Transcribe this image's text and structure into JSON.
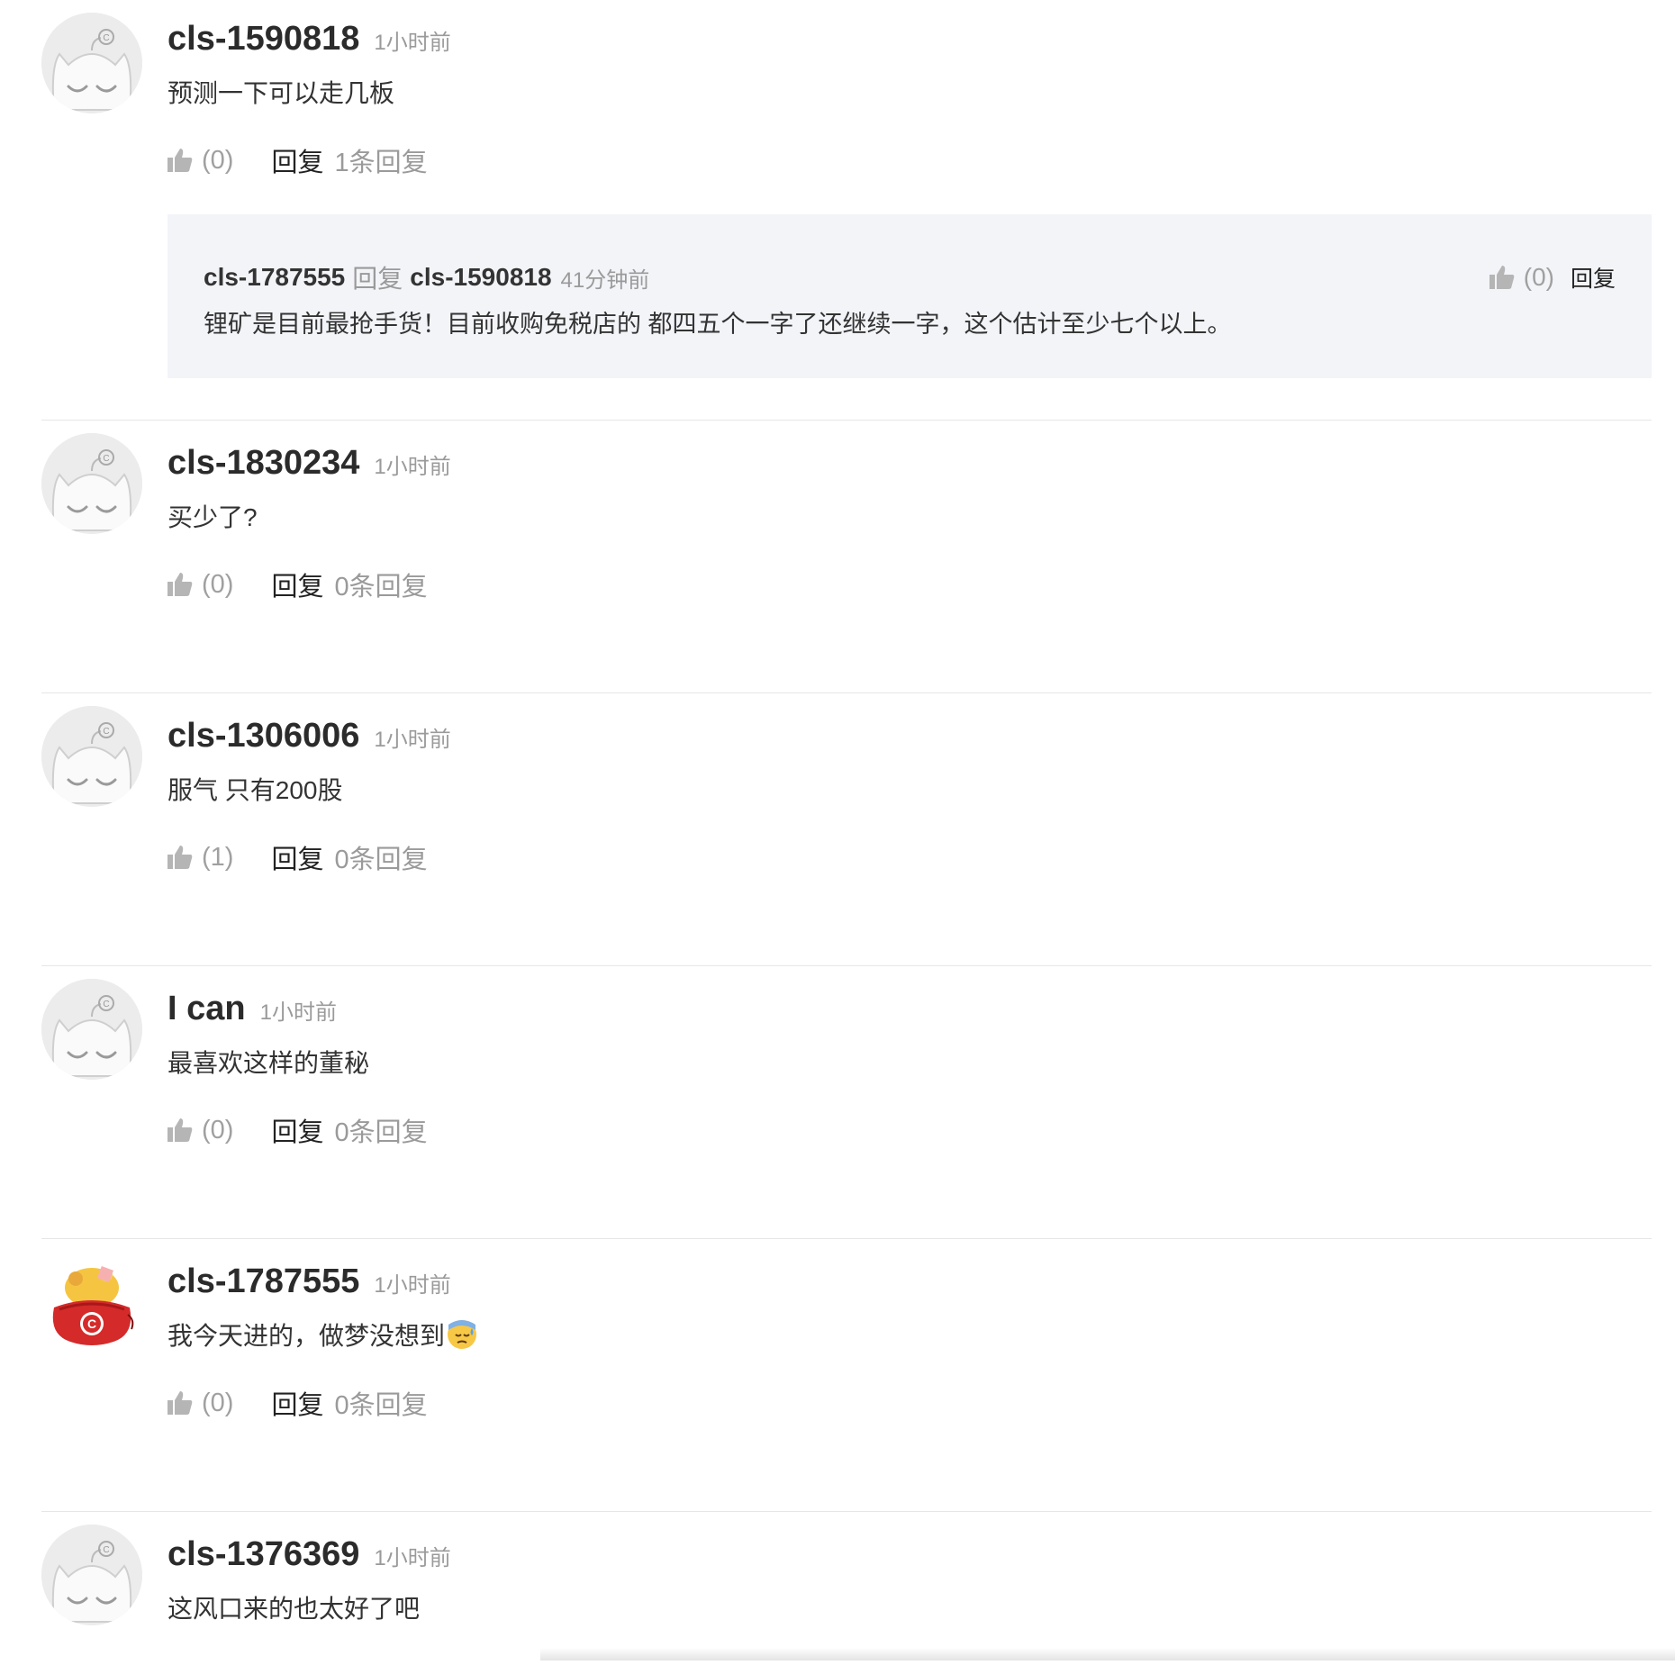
{
  "comments": [
    {
      "user": "cls-1590818",
      "time": "1小时前",
      "text": "预测一下可以走几板",
      "likes": "(0)",
      "reply_label": "回复",
      "reply_count": "1条回复",
      "avatar": "default-cat",
      "replies": [
        {
          "user": "cls-1787555",
          "word": "回复",
          "target": "cls-1590818",
          "time": "41分钟前",
          "likes": "(0)",
          "reply_label": "回复",
          "text": "锂矿是目前最抢手货！目前收购免税店的 都四五个一字了还继续一字，这个估计至少七个以上。"
        }
      ]
    },
    {
      "user": "cls-1830234",
      "time": "1小时前",
      "text": "买少了?",
      "likes": "(0)",
      "reply_label": "回复",
      "reply_count": "0条回复",
      "avatar": "default-cat"
    },
    {
      "user": "cls-1306006",
      "time": "1小时前",
      "text": "服气 只有200股",
      "likes": "(1)",
      "reply_label": "回复",
      "reply_count": "0条回复",
      "avatar": "default-cat"
    },
    {
      "user": "I can",
      "time": "1小时前",
      "text": "最喜欢这样的董秘",
      "likes": "(0)",
      "reply_label": "回复",
      "reply_count": "0条回复",
      "avatar": "default-cat"
    },
    {
      "user": "cls-1787555",
      "time": "1小时前",
      "text": "我今天进的，做梦没想到",
      "emoji": "sweat-face-emoji",
      "likes": "(0)",
      "reply_label": "回复",
      "reply_count": "0条回复",
      "avatar": "lucky-bag"
    },
    {
      "user": "cls-1376369",
      "time": "1小时前",
      "text": "这风口来的也太好了吧",
      "avatar": "default-cat"
    }
  ],
  "colors": {
    "username": "#2b2b2b",
    "muted": "#9a9a9a",
    "reply_bg": "#f3f4f8",
    "divider": "#e6e6e6",
    "brand_red": "#d42a2a"
  }
}
